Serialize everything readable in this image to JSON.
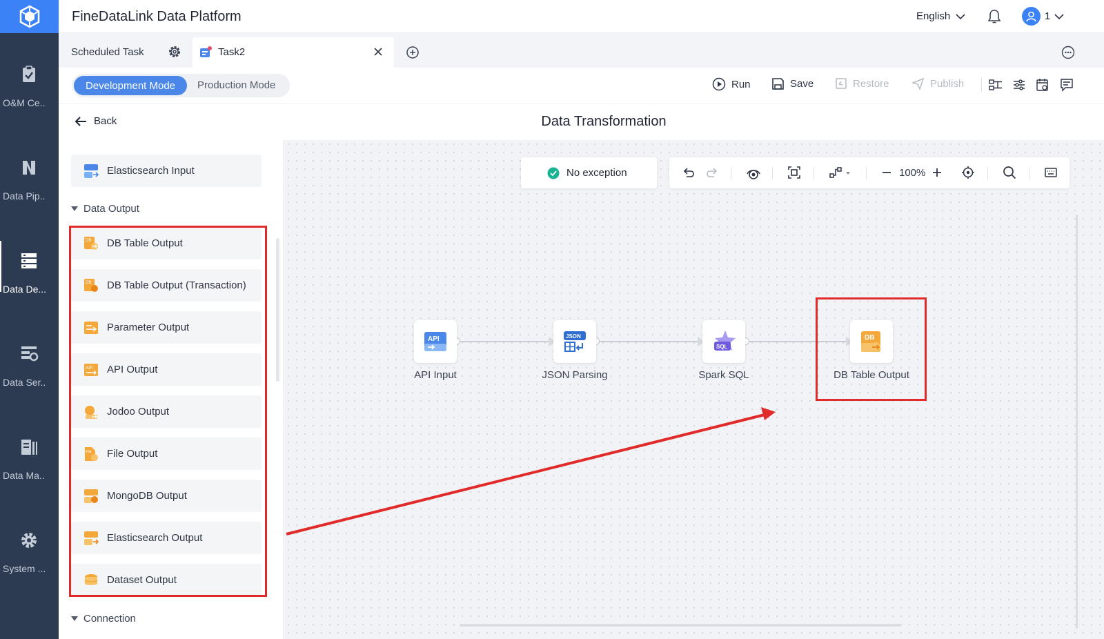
{
  "app": {
    "title": "FineDataLink Data Platform"
  },
  "header": {
    "language": "English",
    "user_count": "1"
  },
  "nav": {
    "items": [
      {
        "label": "O&M Ce..",
        "icon": "clipboard-check-icon"
      },
      {
        "label": "Data Pip..",
        "icon": "pipeline-icon"
      },
      {
        "label": "Data De...",
        "icon": "data-development-icon"
      },
      {
        "label": "Data Ser..",
        "icon": "data-service-icon"
      },
      {
        "label": "Data Ma..",
        "icon": "data-map-icon"
      },
      {
        "label": "System ...",
        "icon": "gear-icon"
      }
    ]
  },
  "tabs": {
    "scheduled": "Scheduled Task",
    "task": "Task2"
  },
  "toolbar": {
    "dev_mode": "Development Mode",
    "prod_mode": "Production Mode",
    "run": "Run",
    "save": "Save",
    "restore": "Restore",
    "publish": "Publish"
  },
  "titlebar": {
    "back": "Back",
    "title": "Data Transformation"
  },
  "panel": {
    "top_item": "Elasticsearch Input",
    "group_output": "Data Output",
    "outputs": [
      "DB Table Output",
      "DB Table Output (Transaction)",
      "Parameter Output",
      "API Output",
      "Jodoo Output",
      "File Output",
      "MongoDB Output",
      "Elasticsearch Output",
      "Dataset Output"
    ],
    "group_connection": "Connection"
  },
  "canvas": {
    "status": "No exception",
    "zoom": "100%",
    "nodes": [
      "API Input",
      "JSON Parsing",
      "Spark SQL",
      "DB Table Output"
    ]
  },
  "colors": {
    "accent": "#4a87e8",
    "nav_bg": "#2d3b52",
    "annotation": "#e12b2b",
    "success": "#19b394"
  }
}
